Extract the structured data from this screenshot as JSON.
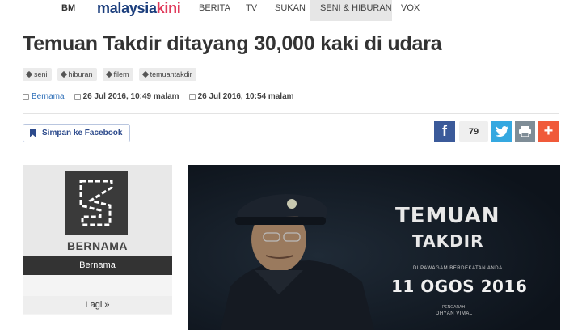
{
  "nav": {
    "lang": "BM",
    "brand_part1": "malaysia",
    "brand_part2": "kini",
    "items": [
      "BERITA",
      "TV",
      "SUKAN",
      "SENI & HIBURAN",
      "VOX"
    ],
    "active": "SENI & HIBURAN"
  },
  "article": {
    "title": "Temuan Takdir ditayang 30,000 kaki di udara",
    "tags": [
      "seni",
      "hiburan",
      "filem",
      "temuantakdir"
    ],
    "author": "Bernama",
    "published": "26 Jul 2016, 10:49 malam",
    "updated": "26 Jul 2016, 10:54 malam"
  },
  "actions": {
    "save_facebook": "Simpan ke Facebook",
    "share_count": "79"
  },
  "sidebar": {
    "logo_text": "BERNAMA",
    "name": "Bernama",
    "more": "Lagi »"
  },
  "poster": {
    "title_line1": "TEMUAN",
    "title_line2": "TAKDIR",
    "subtitle": "DI PAWAGAM BERDEKATAN ANDA",
    "date": "11 OGOS 2016",
    "credit_label": "PENGARAH",
    "director": "DHYAN VIMAL"
  },
  "colors": {
    "brand_blue": "#1a3d7c",
    "brand_pink": "#e03a5b",
    "facebook": "#3b5a9a",
    "twitter": "#35a8e0",
    "print": "#7f8d97",
    "plus": "#f05a3a"
  },
  "icons": [
    "tag-icon",
    "edit-icon",
    "calendar-icon",
    "bookmark-icon",
    "facebook-icon",
    "twitter-icon",
    "print-icon",
    "plus-icon"
  ]
}
